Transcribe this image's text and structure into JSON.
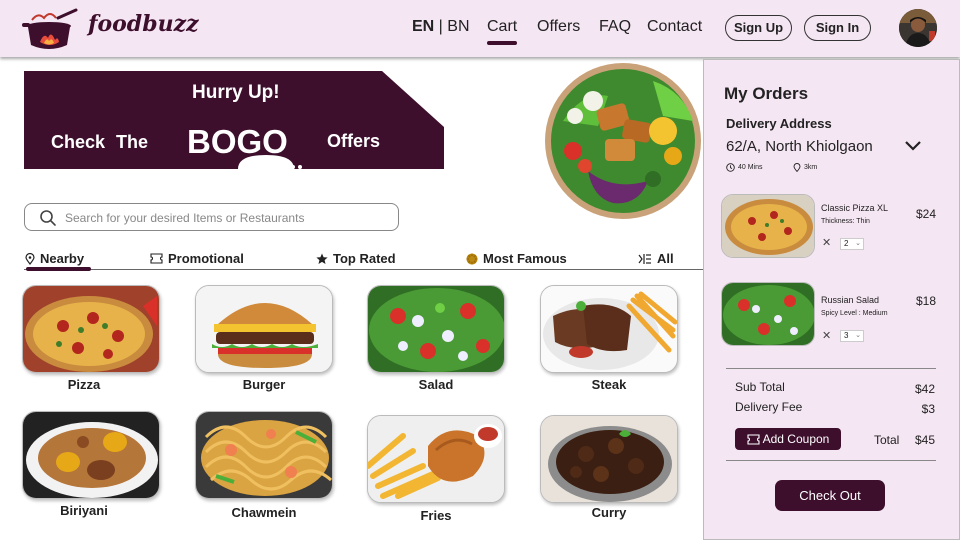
{
  "header": {
    "brand": "foodbuzz",
    "lang_en": "EN",
    "lang_sep": " | ",
    "lang_bn": "BN",
    "nav": {
      "cart": "Cart",
      "offers": "Offers",
      "faq": "FAQ",
      "contact": "Contact"
    },
    "active_nav": "Cart",
    "sign_up": "Sign Up",
    "sign_in": "Sign In"
  },
  "banner": {
    "line1": "Hurry Up!",
    "check": "Check The",
    "bogo": "BOGO",
    "offers": "Offers",
    "slides": 5,
    "active_slide": 1
  },
  "search": {
    "placeholder": "Search for your desired Items or Restaurants",
    "value": ""
  },
  "tabs": [
    {
      "label": "Nearby",
      "icon": "location-pin-icon",
      "active": true
    },
    {
      "label": "Promotional",
      "icon": "ticket-icon",
      "active": false
    },
    {
      "label": "Top Rated",
      "icon": "star-icon",
      "active": false
    },
    {
      "label": "Most Famous",
      "icon": "badge-icon",
      "active": false
    },
    {
      "label": "All",
      "icon": "list-icon",
      "active": false
    }
  ],
  "foods": [
    {
      "name": "Pizza"
    },
    {
      "name": "Burger"
    },
    {
      "name": "Salad"
    },
    {
      "name": "Steak"
    },
    {
      "name": "Biriyani"
    },
    {
      "name": "Chawmein"
    },
    {
      "name": "Fries"
    },
    {
      "name": "Curry"
    }
  ],
  "orders": {
    "title": "My Orders",
    "address_label": "Delivery Address",
    "address": "62/A, North Khiolgaon",
    "eta": "40 Mins",
    "distance": "3km",
    "items": [
      {
        "name": "Classic Pizza XL",
        "detail": "Thickness: Thin",
        "price": "$24",
        "qty": "2"
      },
      {
        "name": "Russian Salad",
        "detail": "Spicy Level : Medium",
        "price": "$18",
        "qty": "3"
      }
    ],
    "subtotal_label": "Sub Total",
    "subtotal": "$42",
    "delivery_label": "Delivery Fee",
    "delivery": "$3",
    "coupon": "Add Coupon",
    "total_label": "Total",
    "total": "$45",
    "checkout": "Check Out"
  },
  "colors": {
    "brand": "#3d0f2c",
    "header_bg": "#f5e6f3",
    "panel_bg": "#f5e6f3"
  }
}
